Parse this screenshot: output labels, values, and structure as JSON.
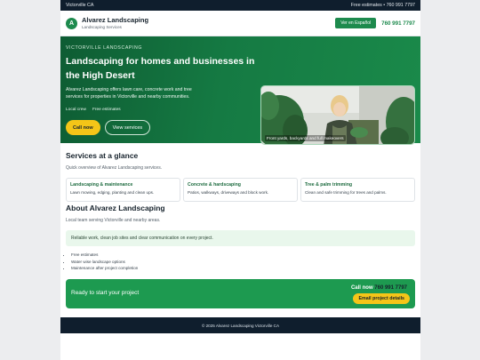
{
  "topbar": {
    "location": "Victorville CA",
    "info": "Free estimates • 760 991 7797"
  },
  "header": {
    "logo_letter": "A",
    "brand_name": "Alvarez Landscaping",
    "brand_sub": "Landscaping Services",
    "lang_button": "Ver en Español",
    "phone": "760 991 7797"
  },
  "hero": {
    "eyebrow": "VICTORVILLE LANDSCAPING",
    "title": "Landscaping for homes and businesses in the High Desert",
    "description": "Alvarez Landscaping offers lawn care, concrete work and tree services for properties in Victorville and nearby communities.",
    "chips": [
      "Local crew",
      "Free estimates"
    ],
    "call_button": "Call now",
    "services_button": "View services",
    "photo_caption": "Front yards, backyards and full makeovers"
  },
  "services": {
    "title": "Services at a glance",
    "subtitle": "Quick overview of Alvarez Landscaping services.",
    "cards": [
      {
        "title": "Landscaping & maintenance",
        "desc": "Lawn mowing, edging, planting and clean ups."
      },
      {
        "title": "Concrete & hardscaping",
        "desc": "Patios, walkways, driveways and block work."
      },
      {
        "title": "Tree & palm trimming",
        "desc": "Clean and safe trimming for trees and palms."
      }
    ]
  },
  "about": {
    "title": "About Alvarez Landscaping",
    "subtitle": "Local team serving Victorville and nearby areas.",
    "callout": "Reliable work, clean job sites and clear communication on every project.",
    "bullets": [
      "Free estimates",
      "Water wise landscape options",
      "Maintenance after project completion"
    ]
  },
  "cta": {
    "text": "Ready to start your project",
    "call_label": "Call now",
    "phone": "760 991 7797",
    "email_button": "Email project details"
  },
  "footer": {
    "text": "© 2025 Alvarez Landscaping Victorville CA"
  },
  "colors": {
    "brand_green": "#1d8a4d",
    "accent_yellow": "#f5c518",
    "dark_navy": "#0f1e2d"
  }
}
